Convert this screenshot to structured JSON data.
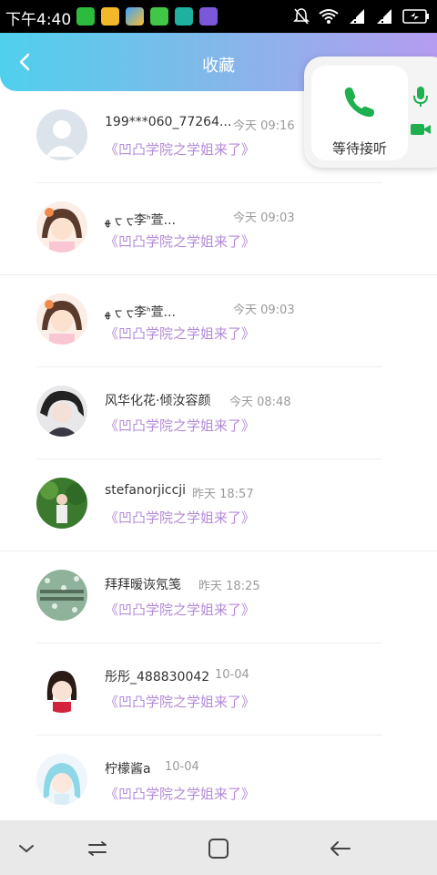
{
  "status_bar": {
    "time": "下午4:40",
    "app_icons": [
      "wechat-icon",
      "folder-icon",
      "gallery-icon",
      "store-icon",
      "scanner-icon",
      "calendar-icon"
    ],
    "indicators": [
      "mute-icon",
      "wifi-icon",
      "signal-icon",
      "signal-icon",
      "battery-charging-icon"
    ]
  },
  "header": {
    "title": "收藏",
    "gradient": [
      "#4fd0ec",
      "#b59cf0"
    ]
  },
  "call": {
    "status": "等待接听",
    "accent": "#1eaf4f"
  },
  "list": [
    {
      "name": "199***060_77264...",
      "time": "今天 09:16",
      "message": "《凹凸学院之学姐来了》"
    },
    {
      "name": "ﻬ ᠸ ᠸ⁠李⁠ᑋ⁠萱...",
      "time": "今天 09:03",
      "message": "《凹凸学院之学姐来了》"
    },
    {
      "name": "ﻬ ᠸ ᠸ⁠李⁠ᑋ⁠萱...",
      "time": "今天 09:03",
      "message": "《凹凸学院之学姐来了》"
    },
    {
      "name": "风华化花·倾汝容颜",
      "time": "今天 08:48",
      "message": "《凹凸学院之学姐来了》"
    },
    {
      "name": "stefanorjiccji",
      "time": "昨天 18:57",
      "message": "《凹凸学院之学姐来了》"
    },
    {
      "name": "拜拜暧诙氖笺",
      "time": "昨天 18:25",
      "message": "《凹凸学院之学姐来了》"
    },
    {
      "name": "彤彤_488830042",
      "time": "10-04",
      "message": "《凹凸学院之学姐来了》"
    },
    {
      "name": "柠檬酱a",
      "time": "10-04",
      "message": "《凹凸学院之学姐来了》"
    }
  ],
  "colors": {
    "message": "#b48ad8",
    "time": "#9a9a9a"
  }
}
